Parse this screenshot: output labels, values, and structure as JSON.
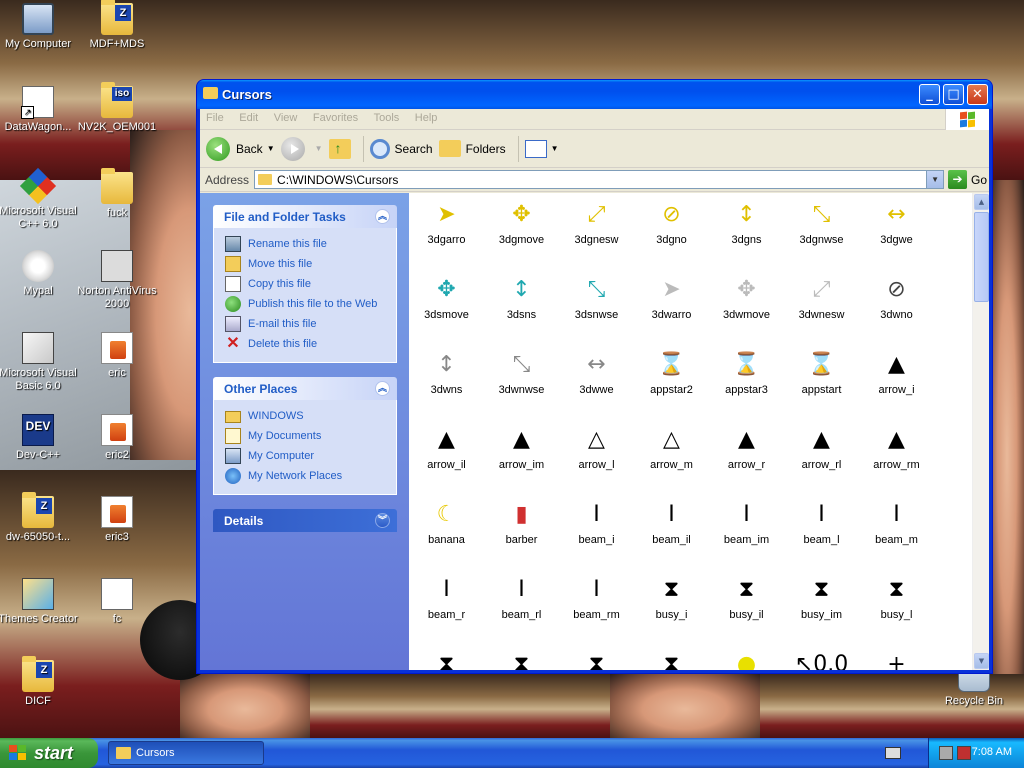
{
  "desktop": {
    "icons": [
      {
        "label": "My Computer",
        "icon": "my-computer-icon"
      },
      {
        "label": "MDF+MDS",
        "icon": "document-icon",
        "badge": "Z"
      },
      {
        "label": "DataWagon...",
        "icon": "shortcut-icon"
      },
      {
        "label": "NV2K_OEM001",
        "icon": "iso-icon",
        "badge": "iso"
      },
      {
        "label": "Microsoft Visual C++ 6.0",
        "icon": "visual-cpp-icon"
      },
      {
        "label": "fuck",
        "icon": "folder-icon"
      },
      {
        "label": "Mypal",
        "icon": "mypal-icon"
      },
      {
        "label": "Norton AntiVirus 2000",
        "icon": "norton-icon"
      },
      {
        "label": "Microsoft Visual Basic 6.0",
        "icon": "visual-basic-icon"
      },
      {
        "label": "eric",
        "icon": "document-icon"
      },
      {
        "label": "Dev-C++",
        "icon": "dev-cpp-icon",
        "badge": "DEV"
      },
      {
        "label": "eric2",
        "icon": "document-icon"
      },
      {
        "label": "dw-65050-t...",
        "icon": "zip-icon",
        "badge": "Z"
      },
      {
        "label": "eric3",
        "icon": "document-icon"
      },
      {
        "label": "Themes Creator",
        "icon": "themes-icon"
      },
      {
        "label": "fc",
        "icon": "document-icon"
      },
      {
        "label": "DICF",
        "icon": "zip-icon",
        "badge": "Z"
      },
      {
        "label": "Recycle Bin",
        "icon": "recycle-bin-icon"
      }
    ]
  },
  "window": {
    "title": "Cursors",
    "menu": [
      "File",
      "Edit",
      "View",
      "Favorites",
      "Tools",
      "Help"
    ],
    "toolbar": {
      "back": "Back",
      "search": "Search",
      "folders": "Folders"
    },
    "address": {
      "label": "Address",
      "value": "C:\\WINDOWS\\Cursors",
      "go": "Go"
    },
    "tasks": {
      "file_folder": {
        "title": "File and Folder Tasks",
        "items": [
          "Rename this file",
          "Move this file",
          "Copy this file",
          "Publish this file to the Web",
          "E-mail this file",
          "Delete this file"
        ]
      },
      "other_places": {
        "title": "Other Places",
        "items": [
          "WINDOWS",
          "My Documents",
          "My Computer",
          "My Network Places"
        ]
      },
      "details": {
        "title": "Details"
      }
    },
    "files": [
      {
        "name": "3dgarro",
        "glyph": "➤",
        "color": "#e0c000"
      },
      {
        "name": "3dgmove",
        "glyph": "✥",
        "color": "#e0c000"
      },
      {
        "name": "3dgnesw",
        "glyph": "⤢",
        "color": "#e0c000"
      },
      {
        "name": "3dgno",
        "glyph": "⊘",
        "color": "#e0c000"
      },
      {
        "name": "3dgns",
        "glyph": "↕",
        "color": "#e0c000"
      },
      {
        "name": "3dgnwse",
        "glyph": "⤡",
        "color": "#e0c000"
      },
      {
        "name": "3dgwe",
        "glyph": "↔",
        "color": "#e0c000"
      },
      {
        "name": "3dsmove",
        "glyph": "✥",
        "color": "#20a8b0"
      },
      {
        "name": "3dsns",
        "glyph": "↕",
        "color": "#20a8b0"
      },
      {
        "name": "3dsnwse",
        "glyph": "⤡",
        "color": "#20a8b0"
      },
      {
        "name": "3dwarro",
        "glyph": "➤",
        "color": "#bbbbbb"
      },
      {
        "name": "3dwmove",
        "glyph": "✥",
        "color": "#bbbbbb"
      },
      {
        "name": "3dwnesw",
        "glyph": "⤢",
        "color": "#bbbbbb"
      },
      {
        "name": "3dwno",
        "glyph": "⊘",
        "color": "#444444"
      },
      {
        "name": "3dwns",
        "glyph": "↕",
        "color": "#888888"
      },
      {
        "name": "3dwnwse",
        "glyph": "⤡",
        "color": "#888888"
      },
      {
        "name": "3dwwe",
        "glyph": "↔",
        "color": "#888888"
      },
      {
        "name": "appstar2",
        "glyph": "⌛",
        "color": "#c0a000"
      },
      {
        "name": "appstar3",
        "glyph": "⌛",
        "color": "#555555"
      },
      {
        "name": "appstart",
        "glyph": "⌛",
        "color": "#555555"
      },
      {
        "name": "arrow_i",
        "glyph": "▲",
        "color": "#000000"
      },
      {
        "name": "arrow_il",
        "glyph": "▲",
        "color": "#000000"
      },
      {
        "name": "arrow_im",
        "glyph": "▲",
        "color": "#000000"
      },
      {
        "name": "arrow_l",
        "glyph": "△",
        "color": "#000000"
      },
      {
        "name": "arrow_m",
        "glyph": "△",
        "color": "#000000"
      },
      {
        "name": "arrow_r",
        "glyph": "▲",
        "color": "#000000"
      },
      {
        "name": "arrow_rl",
        "glyph": "▲",
        "color": "#000000"
      },
      {
        "name": "arrow_rm",
        "glyph": "▲",
        "color": "#000000"
      },
      {
        "name": "banana",
        "glyph": "☾",
        "color": "#e8c800"
      },
      {
        "name": "barber",
        "glyph": "▮",
        "color": "#d03030"
      },
      {
        "name": "beam_i",
        "glyph": "I",
        "color": "#000000"
      },
      {
        "name": "beam_il",
        "glyph": "I",
        "color": "#000000"
      },
      {
        "name": "beam_im",
        "glyph": "I",
        "color": "#000000"
      },
      {
        "name": "beam_l",
        "glyph": "I",
        "color": "#000000"
      },
      {
        "name": "beam_m",
        "glyph": "I",
        "color": "#000000"
      },
      {
        "name": "beam_r",
        "glyph": "I",
        "color": "#000000"
      },
      {
        "name": "beam_rl",
        "glyph": "I",
        "color": "#000000"
      },
      {
        "name": "beam_rm",
        "glyph": "I",
        "color": "#000000"
      },
      {
        "name": "busy_i",
        "glyph": "⧗",
        "color": "#000000"
      },
      {
        "name": "busy_il",
        "glyph": "⧗",
        "color": "#000000"
      },
      {
        "name": "busy_im",
        "glyph": "⧗",
        "color": "#000000"
      },
      {
        "name": "busy_l",
        "glyph": "⧗",
        "color": "#000000"
      },
      {
        "name": "",
        "glyph": "⧗",
        "color": "#000000"
      },
      {
        "name": "",
        "glyph": "⧗",
        "color": "#000000"
      },
      {
        "name": "",
        "glyph": "⧗",
        "color": "#000000"
      },
      {
        "name": "",
        "glyph": "⧗",
        "color": "#000000"
      },
      {
        "name": "",
        "glyph": "●",
        "color": "#e8e000"
      },
      {
        "name": "",
        "glyph": "↖0.0",
        "color": "#000000"
      },
      {
        "name": "",
        "glyph": "+",
        "color": "#000000"
      }
    ]
  },
  "taskbar": {
    "start": "start",
    "task": "Cursors",
    "clock": "7:08 AM"
  }
}
